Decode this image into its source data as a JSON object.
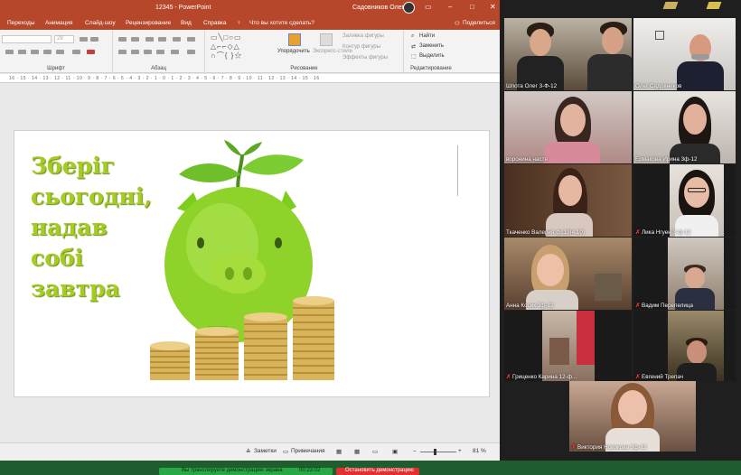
{
  "titlebar": {
    "file": "12345  -  PowerPoint",
    "user": "Садовников Олег"
  },
  "ribbon_tabs": [
    "Переходы",
    "Анимация",
    "Слайд-шоу",
    "Рецензирование",
    "Вид",
    "Справка",
    "Что вы хотите сделать?",
    "Поделиться"
  ],
  "ribbon": {
    "font_size": "28",
    "groups": {
      "font": "Шрифт",
      "paragraph": "Абзац",
      "drawing": "Рисование",
      "editing": "Редактирование"
    },
    "drawing_items": {
      "arrange": "Упорядочить",
      "quick_styles": "Экспресс-стили",
      "fill": "Заливка фигуры",
      "outline": "Контур фигуры",
      "effects": "Эффекты фигуры"
    },
    "editing_items": {
      "find": "Найти",
      "replace": "Заменить",
      "select": "Выделить"
    }
  },
  "ruler_text": "16 · 15 · 14 · 13 · 12 · 11 · 10 · 9 · 8 · 7 · 6 · 5 · 4 · 3 · 2 · 1 · 0 · 1 · 2 · 3 · 4 · 5 · 6 · 7 · 8 · 9 · 10 · 11 · 12 · 13 · 14 · 15 · 16",
  "slide": {
    "lines": [
      "Зберіг",
      "сьогодні,",
      "надав",
      "собі",
      "завтра"
    ]
  },
  "statusbar": {
    "notes": "Заметки",
    "comments": "Примечания",
    "zoom": "81 %"
  },
  "share_bar": {
    "text": "Вы транслируете демонстрацию экрана",
    "time": "00:23:02",
    "stop": "Остановить демонстрацию"
  },
  "participants": [
    {
      "name": "Шпота Олег 3-Ф-12",
      "muted": false
    },
    {
      "name": "Олег Садовников",
      "muted": false
    },
    {
      "name": "воронина настя",
      "muted": false
    },
    {
      "name": "Ермакова Ирина 3ф-12",
      "muted": false
    },
    {
      "name": "Ткаченко Валерия фс19(4.10)",
      "muted": false
    },
    {
      "name": "Лика Нгуен 3-ф-12",
      "muted": true
    },
    {
      "name": "Анна Косик 3ф-12",
      "muted": false
    },
    {
      "name": "Вадим Перепелица",
      "muted": true
    },
    {
      "name": "Гриценко Карина 12-ф...",
      "muted": true
    },
    {
      "name": "Евгений Трепач",
      "muted": true
    },
    {
      "name": "Виктория Новикова 3ф-12",
      "muted": true
    }
  ],
  "colors": {
    "ppt_accent": "#b7472a",
    "slide_text": "#a4cc21",
    "active_speaker": "#c3d94e",
    "share_green": "#27a844",
    "stop_red": "#e03030"
  }
}
